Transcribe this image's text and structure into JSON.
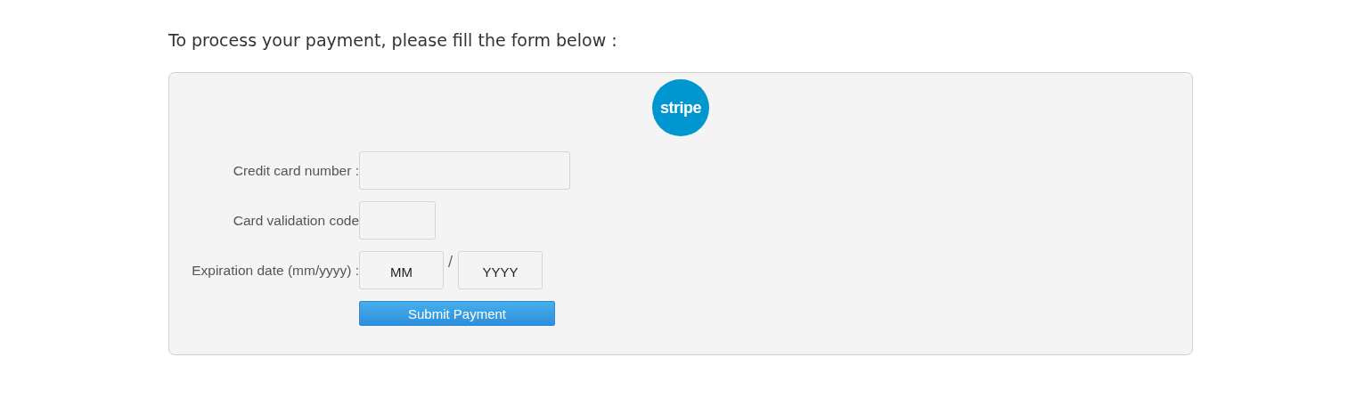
{
  "intro": "To process your payment, please fill the form below :",
  "logo": {
    "text": "stripe"
  },
  "fields": [
    {
      "kind": "wide",
      "label": "Credit card number :"
    },
    {
      "kind": "short",
      "label": "Card validation code"
    },
    {
      "kind": "date",
      "label": "Expiration date (mm/yyyy) :",
      "month": "MM",
      "separator": "/",
      "year": "YYYY"
    }
  ],
  "submit": "Submit Payment"
}
